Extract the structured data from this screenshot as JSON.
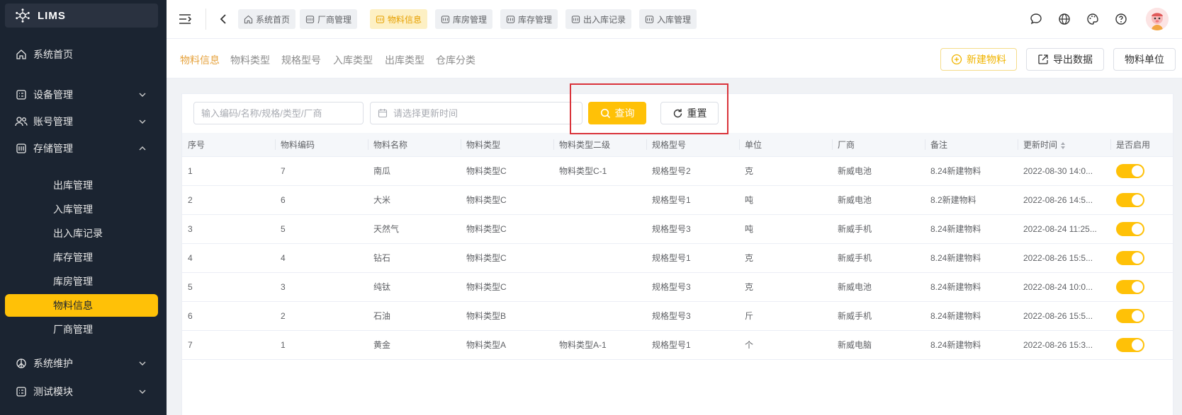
{
  "app": {
    "name": "LIMS"
  },
  "sidebar": {
    "home": "系统首页",
    "groups": [
      {
        "label": "设备管理",
        "icon": "grid-icon"
      },
      {
        "label": "账号管理",
        "icon": "users-icon"
      },
      {
        "label": "存储管理",
        "icon": "storage-icon"
      }
    ],
    "storage_items": [
      "出库管理",
      "入库管理",
      "出入库记录",
      "库存管理",
      "库房管理",
      "物料信息",
      "厂商管理"
    ],
    "active_item": "物料信息",
    "bottom_groups": [
      {
        "label": "系统维护",
        "icon": "peace-icon"
      },
      {
        "label": "测试模块",
        "icon": "grid-icon"
      }
    ]
  },
  "tabs": [
    {
      "label": "系统首页",
      "icon": "home-icon",
      "active": false
    },
    {
      "label": "厂商管理",
      "icon": "module-icon",
      "active": false
    },
    {
      "label": "物料信息",
      "icon": "module-icon",
      "active": true
    },
    {
      "label": "库房管理",
      "icon": "module-icon",
      "active": false
    },
    {
      "label": "库存管理",
      "icon": "module-icon",
      "active": false
    },
    {
      "label": "出入库记录",
      "icon": "module-icon",
      "active": false
    },
    {
      "label": "入库管理",
      "icon": "module-icon",
      "active": false
    }
  ],
  "subtabs": [
    "物料信息",
    "物料类型",
    "规格型号",
    "入库类型",
    "出库类型",
    "仓库分类"
  ],
  "actions": {
    "new_material": "新建物料",
    "export": "导出数据",
    "unit": "物料单位"
  },
  "search": {
    "keyword_placeholder": "输入编码/名称/规格/类型/厂商",
    "date_placeholder": "请选择更新时间",
    "query_label": "查询",
    "reset_label": "重置"
  },
  "table": {
    "columns": [
      "序号",
      "物料编码",
      "物料名称",
      "物料类型",
      "物料类型二级",
      "规格型号",
      "单位",
      "厂商",
      "备注",
      "更新时间",
      "是否启用"
    ],
    "rows": [
      [
        "1",
        "7",
        "南瓜",
        "物料类型C",
        "物料类型C-1",
        "规格型号2",
        "克",
        "新威电池",
        "8.24新建物料",
        "2022-08-30 14:0..."
      ],
      [
        "2",
        "6",
        "大米",
        "物料类型C",
        "",
        "规格型号1",
        "吨",
        "新威电池",
        "8.2新建物料",
        "2022-08-26 14:5..."
      ],
      [
        "3",
        "5",
        "天然气",
        "物料类型C",
        "",
        "规格型号3",
        "吨",
        "新威手机",
        "8.24新建物料",
        "2022-08-24 11:25..."
      ],
      [
        "4",
        "4",
        "钻石",
        "物料类型C",
        "",
        "规格型号1",
        "克",
        "新威手机",
        "8.24新建物料",
        "2022-08-26 15:5..."
      ],
      [
        "5",
        "3",
        "纯钛",
        "物料类型C",
        "",
        "规格型号3",
        "克",
        "新威电池",
        "8.24新建物料",
        "2022-08-24 10:0..."
      ],
      [
        "6",
        "2",
        "石油",
        "物料类型B",
        "",
        "规格型号3",
        "斤",
        "新威手机",
        "8.24新建物料",
        "2022-08-26 15:5..."
      ],
      [
        "7",
        "1",
        "黄金",
        "物料类型A",
        "物料类型A-1",
        "规格型号1",
        "个",
        "新威电脑",
        "8.24新建物料",
        "2022-08-26 15:3..."
      ]
    ],
    "enabled": [
      true,
      true,
      true,
      true,
      true,
      true,
      true
    ]
  },
  "colors": {
    "accent": "#ffc107",
    "sidebar_bg": "#1b2431",
    "highlight_box": "#d9333a"
  }
}
